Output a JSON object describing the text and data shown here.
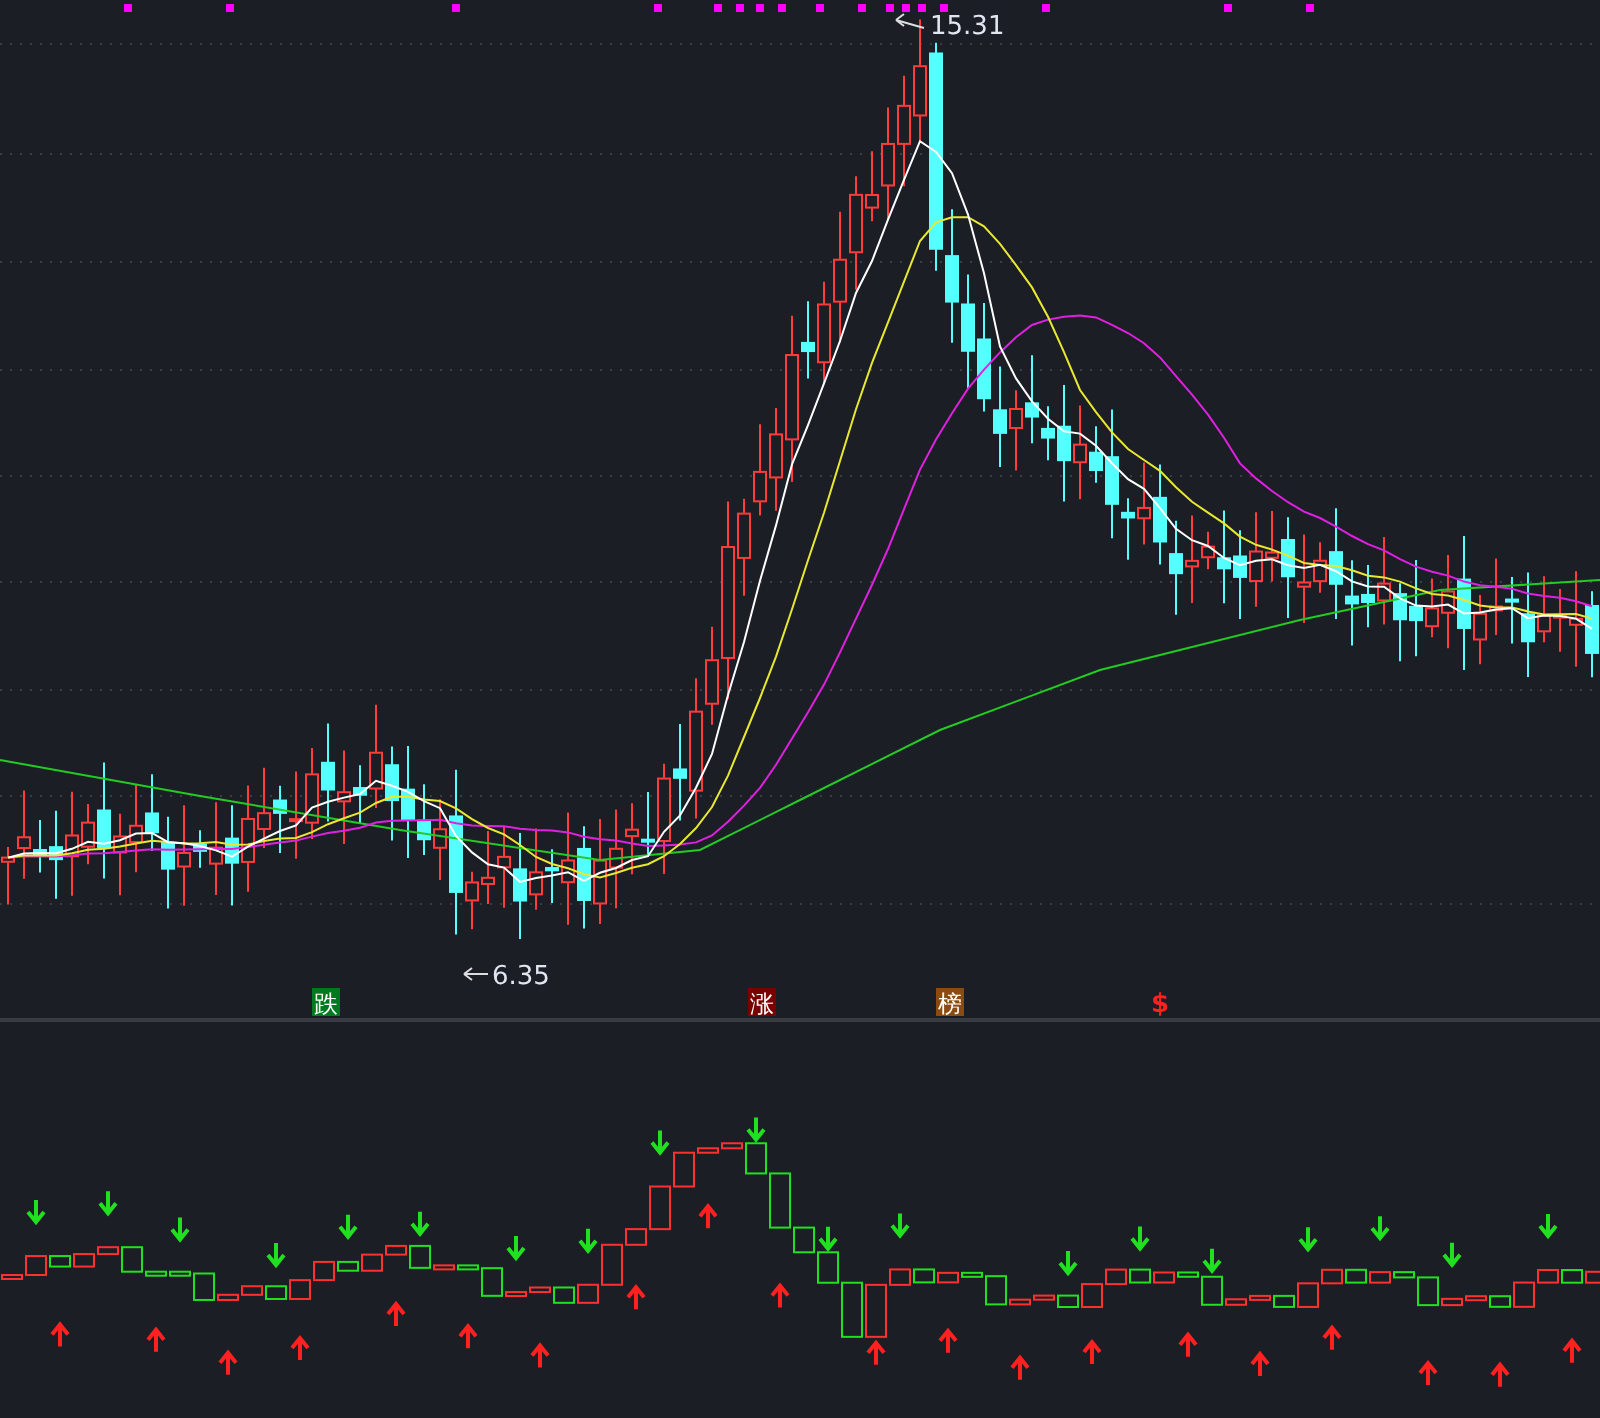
{
  "chart": {
    "high_label": "15.31",
    "low_label": "6.35",
    "signals": [
      {
        "text": "跌",
        "kind": "badge",
        "color": "#007a1f"
      },
      {
        "text": "涨",
        "kind": "badge",
        "color": "#7a0000"
      },
      {
        "text": "榜",
        "kind": "badge",
        "color": "#8a4a10"
      },
      {
        "text": "$",
        "kind": "glyph",
        "color": "#ff2020"
      }
    ]
  }
}
